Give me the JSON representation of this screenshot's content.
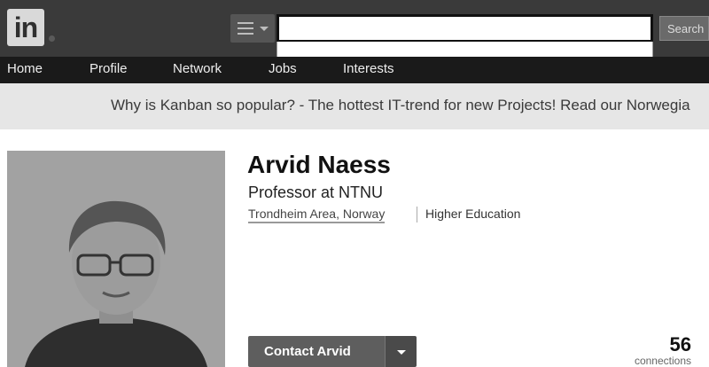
{
  "header": {
    "logo_text": "in",
    "search": {
      "value": "",
      "placeholder": "",
      "button_label": "Search"
    }
  },
  "nav": {
    "items": [
      "Home",
      "Profile",
      "Network",
      "Jobs",
      "Interests"
    ]
  },
  "promo": {
    "text": "Why is Kanban so popular? - The hottest IT-trend for new Projects! Read our Norwegia"
  },
  "profile": {
    "name": "Arvid Naess",
    "headline": "Professor at NTNU",
    "location": "Trondheim Area, Norway",
    "industry": "Higher Education",
    "contact_label": "Contact Arvid",
    "connections": {
      "count": "56",
      "label": "connections"
    }
  }
}
